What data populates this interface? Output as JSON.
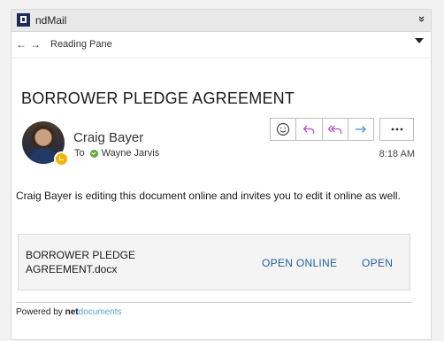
{
  "app": {
    "name": "ndMail",
    "collapse_icon": "double-chevron-icon"
  },
  "nav": {
    "title": "Reading Pane",
    "back_icon": "arrow-left-icon",
    "forward_icon": "arrow-right-icon",
    "menu_icon": "caret-down-icon"
  },
  "message": {
    "subject": "BORROWER PLEDGE AGREEMENT",
    "sender": "Craig Bayer",
    "to_label": "To",
    "recipient": "Wayne Jarvis",
    "time": "8:18 AM",
    "body": "Craig Bayer is editing this document online and invites you to edit it online as well."
  },
  "actions": {
    "icons": [
      "smiley-icon",
      "reply-icon",
      "reply-all-icon",
      "forward-icon"
    ],
    "more_icon": "more-horizontal-icon"
  },
  "attachment": {
    "filename": "BORROWER PLEDGE AGREEMENT.docx",
    "open_online_label": "OPEN ONLINE",
    "open_label": "OPEN"
  },
  "footer": {
    "prefix": "Powered by ",
    "brand_part1": "net",
    "brand_part2": "documents"
  },
  "colors": {
    "link": "#1f5f9f",
    "reply_accent": "#b44fc3",
    "forward_accent": "#4a90d9",
    "presence_away": "#f2b400",
    "presence_available": "#5fa93c",
    "brand_accent": "#58a3d8"
  }
}
